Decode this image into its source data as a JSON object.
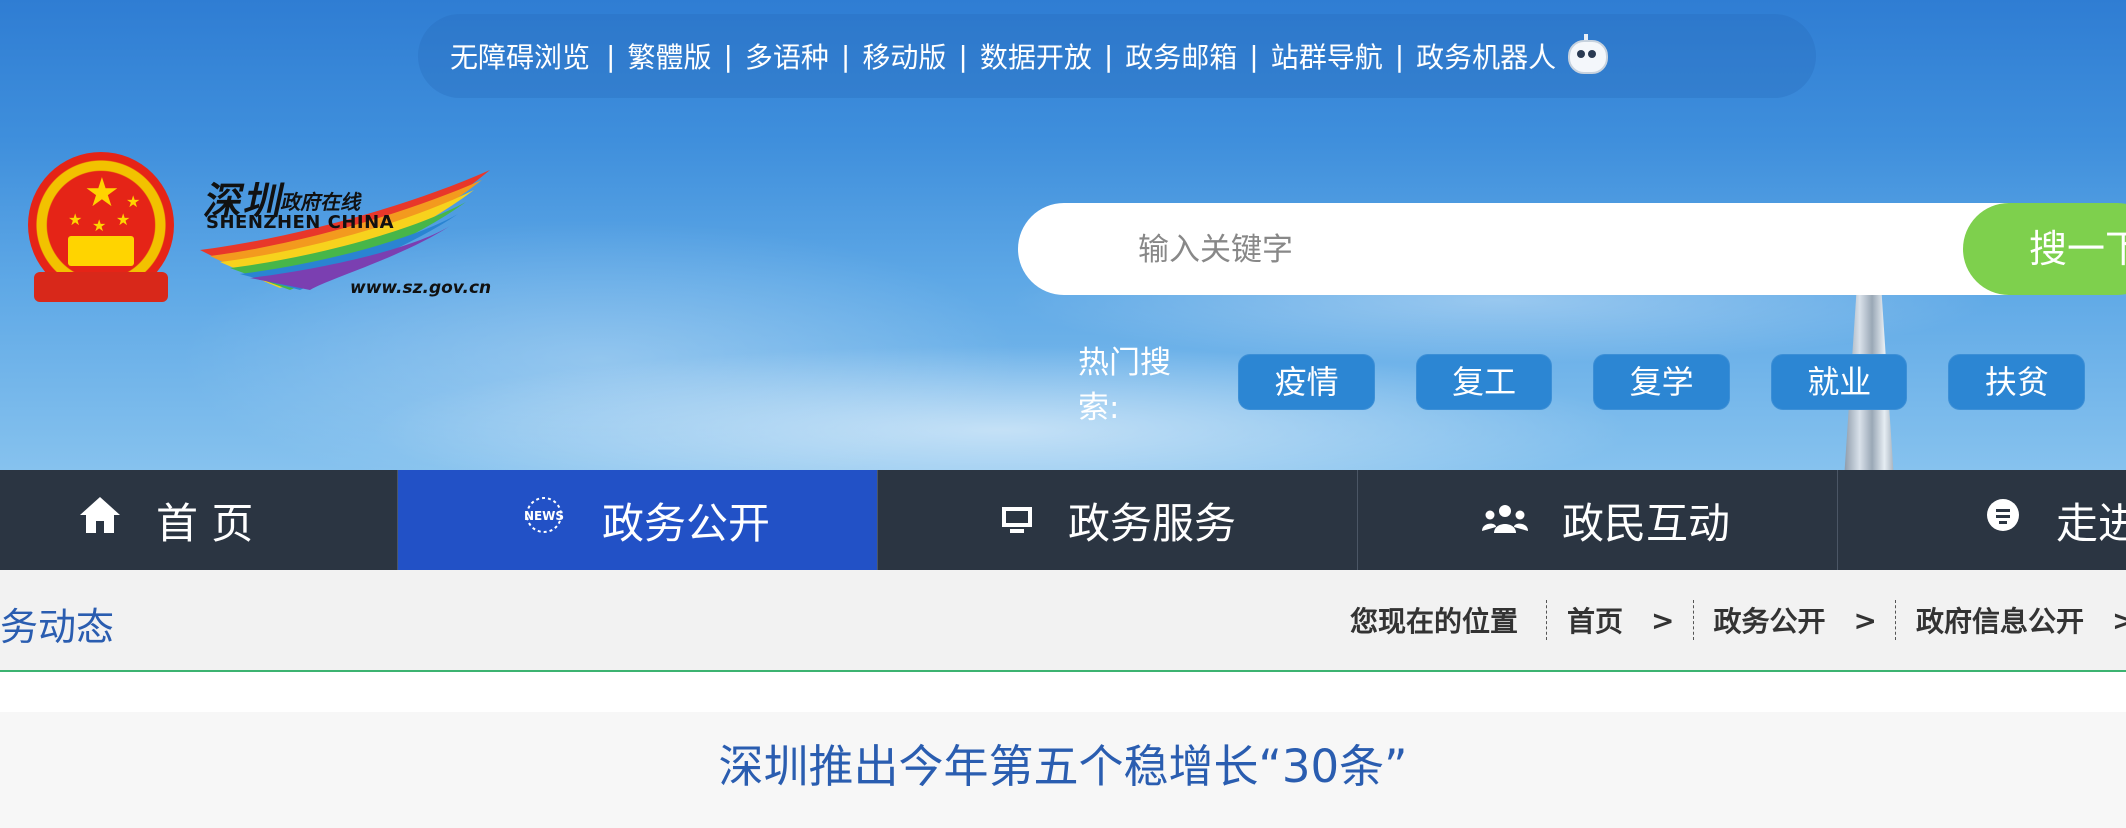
{
  "header": {
    "top_links": [
      "无障碍浏览",
      "繁體版",
      "多语种",
      "移动版",
      "数据开放",
      "政务邮箱",
      "站群导航",
      "政务机器人"
    ],
    "logo": {
      "cn_main": "深圳",
      "cn_sub": "政府在线",
      "en": "SHENZHEN CHINA",
      "url": "www.sz.gov.cn"
    },
    "search": {
      "placeholder": "输入关键字",
      "button_label": "搜一下"
    },
    "hot_search": {
      "label": "热门搜索:",
      "tags": [
        "疫情",
        "复工",
        "复学",
        "就业",
        "扶贫"
      ]
    }
  },
  "nav": {
    "items": [
      {
        "label": "首 页",
        "icon": "home-icon",
        "active": false
      },
      {
        "label": "政务公开",
        "icon": "news-icon",
        "active": true
      },
      {
        "label": "政务服务",
        "icon": "monitor-icon",
        "active": false
      },
      {
        "label": "政民互动",
        "icon": "people-icon",
        "active": false
      },
      {
        "label": "走进深圳",
        "icon": "chat-bubble-icon",
        "active": false
      }
    ]
  },
  "breadcrumb": {
    "section_title": "政务动态",
    "prefix": "您现在的位置",
    "items": [
      "首页",
      "政务公开",
      "政府信息公开"
    ],
    "separator": ">"
  },
  "article": {
    "title": "深圳推出今年第五个稳增长“30条”"
  },
  "colors": {
    "nav_bg": "#2b3542",
    "nav_active": "#2251c6",
    "search_button": "#7ed04d",
    "link_blue": "#2a5db0",
    "divider_green": "#3cb371"
  }
}
